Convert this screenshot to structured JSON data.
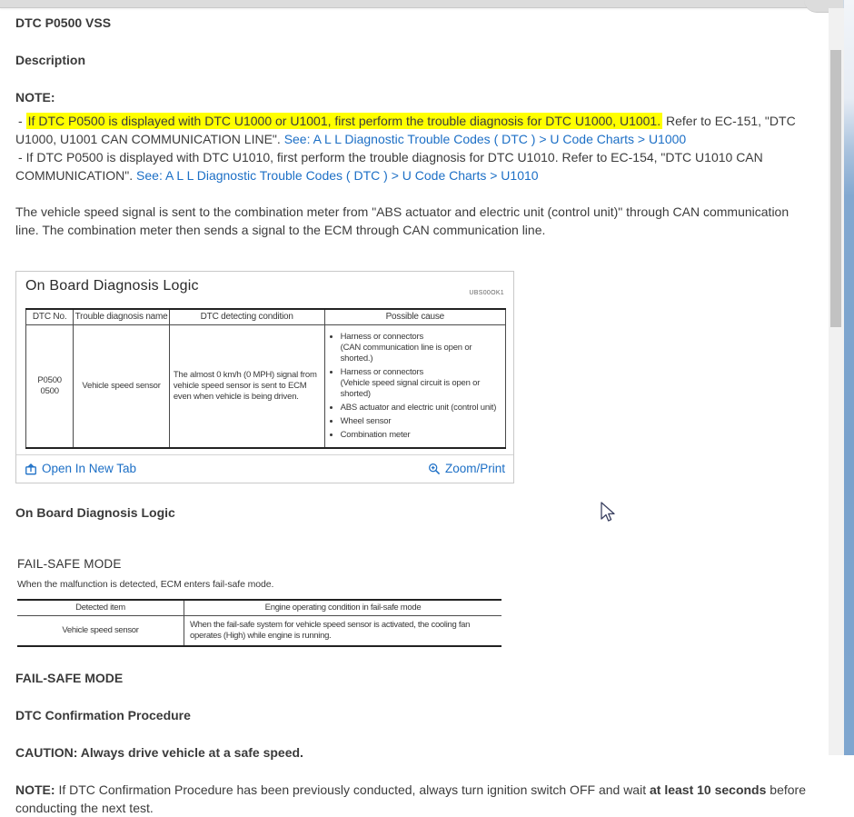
{
  "doc": {
    "title": "DTC P0500 VSS",
    "description_heading": "Description",
    "note_heading": "NOTE:",
    "note1": {
      "dash": "-",
      "highlighted": "If DTC P0500 is displayed with DTC U1000 or U1001, first perform the trouble diagnosis for DTC U1000, U1001.",
      "plain": " Refer to EC-151, \"DTC U1000, U1001 CAN COMMUNICATION LINE\". ",
      "link": "See: A L L Diagnostic Trouble Codes ( DTC ) > U Code Charts > U1000"
    },
    "note2": {
      "dash": "-",
      "plain": "If DTC P0500 is displayed with DTC U1010, first perform the trouble diagnosis for DTC U1010. Refer to EC-154, \"DTC U1010 CAN COMMUNICATION\". ",
      "link": "See: A L L Diagnostic Trouble Codes ( DTC ) > U Code Charts > U1010"
    },
    "intro_paragraph": "The vehicle speed signal is sent to the combination meter from \"ABS actuator and electric unit (control unit)\" through CAN communication line. The combination meter then sends a signal to the ECM through CAN communication line.",
    "obdl_heading": "On Board Diagnosis Logic",
    "failsafe_heading": "FAIL-SAFE MODE",
    "dtc_confirmation_heading": "DTC Confirmation Procedure",
    "caution": "CAUTION: Always drive vehicle at a safe speed.",
    "final_note": {
      "label": "NOTE:",
      "text_before": " If DTC Confirmation Procedure has been previously conducted, always turn ignition switch OFF and wait ",
      "bold": "at least 10 seconds",
      "text_after": " before conducting the next test."
    }
  },
  "figure1": {
    "title": "On Board Diagnosis Logic",
    "code": "UBS00OK1",
    "headers": [
      "DTC No.",
      "Trouble diagnosis name",
      "DTC detecting condition",
      "Possible cause"
    ],
    "row": {
      "dtc_no": [
        "P0500",
        "0500"
      ],
      "name": "Vehicle speed sensor",
      "condition": "The almost 0 km/h (0 MPH) signal from vehicle speed sensor is sent to ECM even when vehicle is being driven.",
      "causes": [
        {
          "main": "Harness or connectors",
          "sub": "(CAN communication line is open or shorted.)"
        },
        {
          "main": "Harness or connectors",
          "sub": "(Vehicle speed signal circuit is open or shorted)"
        },
        {
          "main": "ABS actuator and electric unit (control unit)",
          "sub": ""
        },
        {
          "main": "Wheel sensor",
          "sub": ""
        },
        {
          "main": "Combination meter",
          "sub": ""
        }
      ]
    },
    "open_in_new_tab": "Open In New Tab",
    "zoom_print": "Zoom/Print"
  },
  "figure2": {
    "title": "FAIL-SAFE MODE",
    "subtitle": "When the malfunction is detected, ECM enters fail-safe mode.",
    "headers": [
      "Detected item",
      "Engine operating condition in fail-safe mode"
    ],
    "rows": [
      [
        "Vehicle speed sensor",
        "When the fail-safe system for vehicle speed sensor is activated, the cooling fan operates (High) while engine is running."
      ]
    ]
  },
  "colors": {
    "link_blue": "#1c6fc6",
    "highlight_yellow": "#ffff00",
    "accent_strip": "#7aa2cc"
  }
}
